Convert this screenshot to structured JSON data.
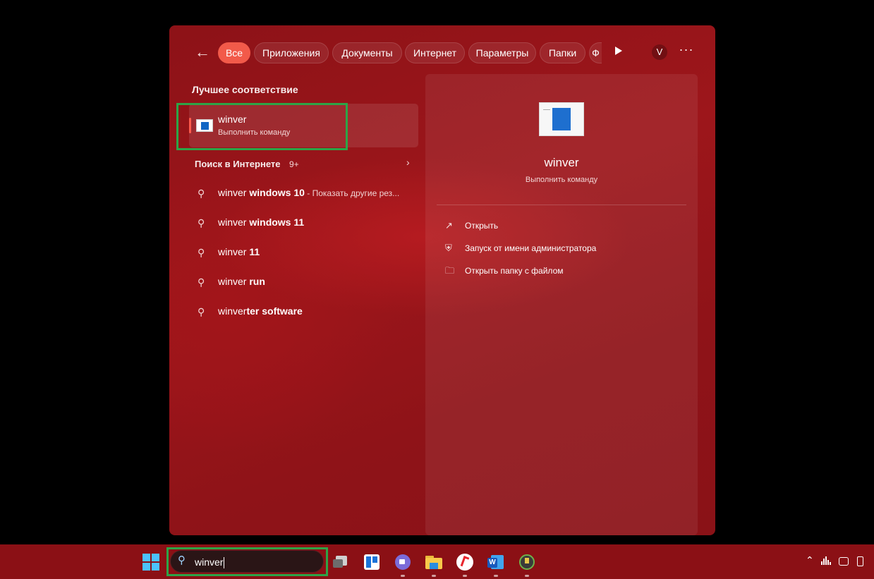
{
  "filters": {
    "back": "←",
    "chips": [
      "Все",
      "Приложения",
      "Документы",
      "Интернет",
      "Параметры",
      "Папки",
      "Ф"
    ],
    "active_index": 0,
    "avatar": "V",
    "more": "···"
  },
  "best": {
    "title": "Лучшее соответствие",
    "name": "winver",
    "sub": "Выполнить команду"
  },
  "web": {
    "title": "Поиск в Интернете",
    "count": "9+",
    "chevron": "›",
    "suggestions": [
      {
        "prefix": "winver",
        "bold": " windows 10",
        "extra": " - Показать другие рез..."
      },
      {
        "prefix": "winver",
        "bold": " windows 11",
        "extra": ""
      },
      {
        "prefix": "winver",
        "bold": " 11",
        "extra": ""
      },
      {
        "prefix": "winver",
        "bold": " run",
        "extra": ""
      },
      {
        "prefix": "winver",
        "bold": "ter software",
        "extra": ""
      }
    ]
  },
  "detail": {
    "name": "winver",
    "sub": "Выполнить команду",
    "actions": [
      {
        "icon": "open-external-icon",
        "glyph": "↗",
        "label": "Открыть"
      },
      {
        "icon": "admin-shield-icon",
        "glyph": "⛨",
        "label": "Запуск от имени администратора"
      },
      {
        "icon": "folder-icon",
        "glyph": "🗀",
        "label": "Открыть папку с файлом"
      }
    ]
  },
  "taskbar": {
    "search_value": "winver",
    "colors": {
      "start": "#4cc2ff",
      "highlight": "#2da447",
      "accent_chip": "#f25a4a"
    }
  }
}
